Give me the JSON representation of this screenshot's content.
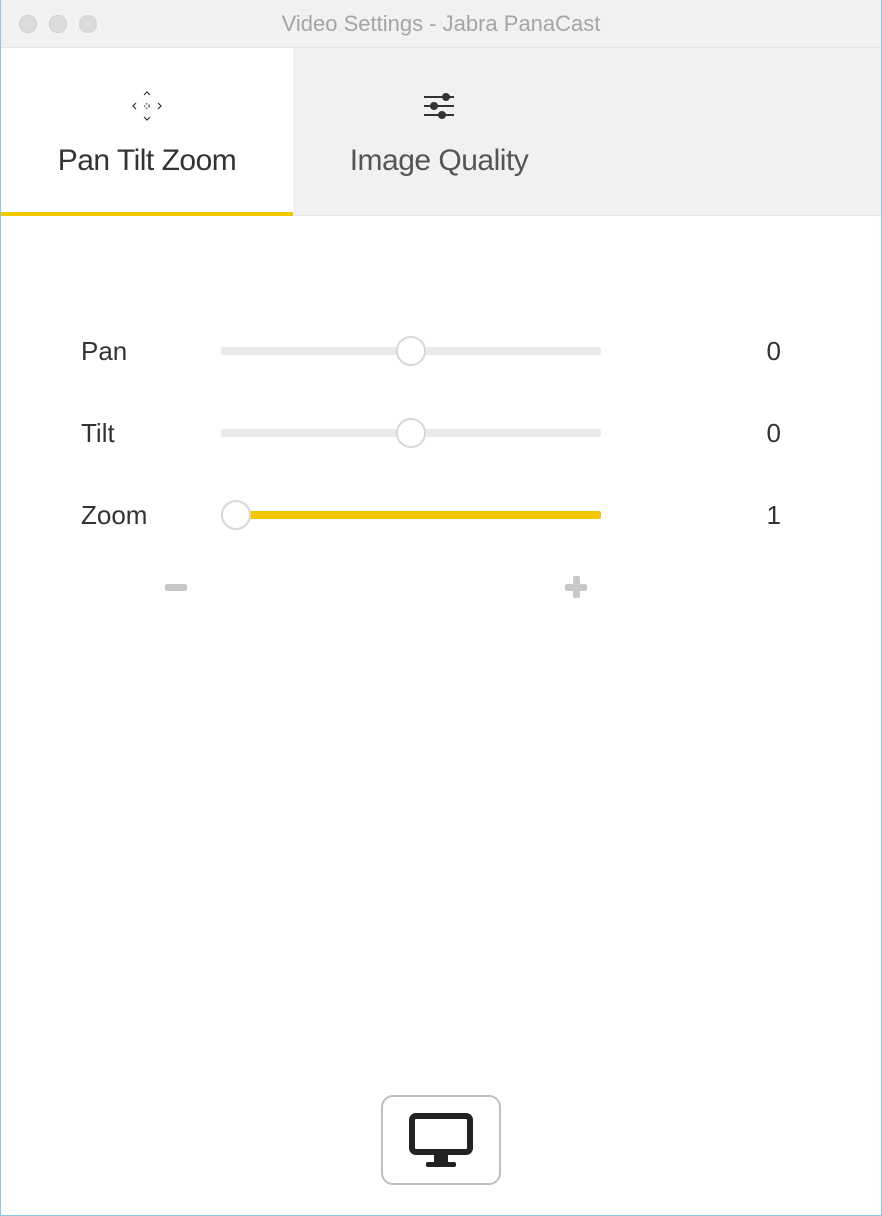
{
  "window": {
    "title": "Video Settings - Jabra PanaCast"
  },
  "tabs": {
    "ptz": {
      "label": "Pan Tilt Zoom",
      "active": true
    },
    "iq": {
      "label": "Image Quality",
      "active": false
    }
  },
  "sliders": {
    "pan": {
      "label": "Pan",
      "value": "0",
      "percent": 50,
      "fillFrom": 50,
      "fillTo": 50
    },
    "tilt": {
      "label": "Tilt",
      "value": "0",
      "percent": 50,
      "fillFrom": 50,
      "fillTo": 50
    },
    "zoom": {
      "label": "Zoom",
      "value": "1",
      "percent": 4,
      "fillFrom": 4,
      "fillTo": 100
    }
  },
  "zoomButtons": {
    "minus": "–",
    "plus": "+"
  },
  "colors": {
    "accent": "#f2c700",
    "track": "#eaeaea"
  }
}
